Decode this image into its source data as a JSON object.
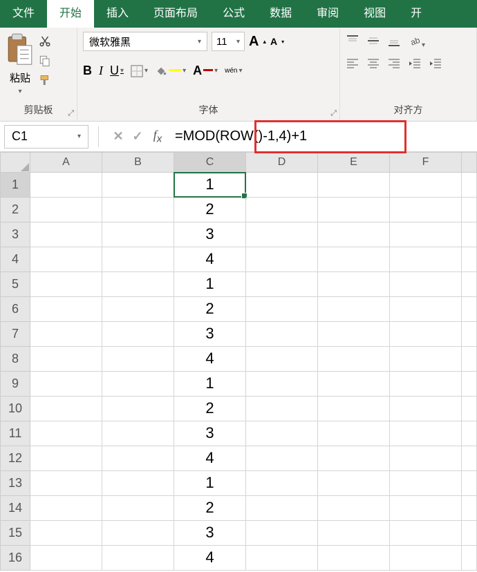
{
  "tabs": {
    "file": "文件",
    "home": "开始",
    "insert": "插入",
    "layout": "页面布局",
    "formulas": "公式",
    "data": "数据",
    "review": "审阅",
    "view": "视图",
    "more": "开"
  },
  "ribbon": {
    "clipboard": {
      "paste": "粘贴",
      "group": "剪贴板"
    },
    "font": {
      "name": "微软雅黑",
      "size": "11",
      "inc": "A",
      "dec": "A",
      "bold": "B",
      "italic": "I",
      "underline": "U",
      "wen": "wén",
      "group": "字体"
    },
    "alignment": {
      "group": "对齐方"
    }
  },
  "namebox": "C1",
  "formula": "=MOD(ROW()-1,4)+1",
  "columns": [
    "A",
    "B",
    "C",
    "D",
    "E",
    "F"
  ],
  "selected_col_index": 2,
  "selected_row_index": 0,
  "rows": [
    {
      "n": "1",
      "c": [
        "",
        "",
        "1",
        "",
        "",
        ""
      ]
    },
    {
      "n": "2",
      "c": [
        "",
        "",
        "2",
        "",
        "",
        ""
      ]
    },
    {
      "n": "3",
      "c": [
        "",
        "",
        "3",
        "",
        "",
        ""
      ]
    },
    {
      "n": "4",
      "c": [
        "",
        "",
        "4",
        "",
        "",
        ""
      ]
    },
    {
      "n": "5",
      "c": [
        "",
        "",
        "1",
        "",
        "",
        ""
      ]
    },
    {
      "n": "6",
      "c": [
        "",
        "",
        "2",
        "",
        "",
        ""
      ]
    },
    {
      "n": "7",
      "c": [
        "",
        "",
        "3",
        "",
        "",
        ""
      ]
    },
    {
      "n": "8",
      "c": [
        "",
        "",
        "4",
        "",
        "",
        ""
      ]
    },
    {
      "n": "9",
      "c": [
        "",
        "",
        "1",
        "",
        "",
        ""
      ]
    },
    {
      "n": "10",
      "c": [
        "",
        "",
        "2",
        "",
        "",
        ""
      ]
    },
    {
      "n": "11",
      "c": [
        "",
        "",
        "3",
        "",
        "",
        ""
      ]
    },
    {
      "n": "12",
      "c": [
        "",
        "",
        "4",
        "",
        "",
        ""
      ]
    },
    {
      "n": "13",
      "c": [
        "",
        "",
        "1",
        "",
        "",
        ""
      ]
    },
    {
      "n": "14",
      "c": [
        "",
        "",
        "2",
        "",
        "",
        ""
      ]
    },
    {
      "n": "15",
      "c": [
        "",
        "",
        "3",
        "",
        "",
        ""
      ]
    },
    {
      "n": "16",
      "c": [
        "",
        "",
        "4",
        "",
        "",
        ""
      ]
    }
  ]
}
